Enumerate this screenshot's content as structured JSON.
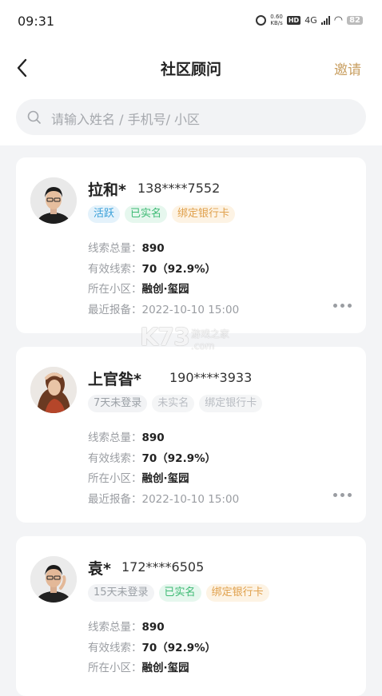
{
  "status_bar": {
    "time": "09:31",
    "speed": "0.60",
    "speed_unit": "KB/s",
    "hd": "HD",
    "network": "4G",
    "battery": "82"
  },
  "nav": {
    "title": "社区顾问",
    "invite": "邀请"
  },
  "search": {
    "placeholder": "请输入姓名 / 手机号/ 小区"
  },
  "labels": {
    "total": "线索总量：",
    "valid": "有效线索：",
    "community": "所在小区：",
    "recent": "最近报备："
  },
  "advisors": [
    {
      "name": "拉和*",
      "phone": "138****7552",
      "tags": [
        {
          "text": "活跃",
          "style": "blue"
        },
        {
          "text": "已实名",
          "style": "green"
        },
        {
          "text": "绑定银行卡",
          "style": "orange"
        }
      ],
      "total": "890",
      "valid": "70（92.9%）",
      "community": "融创·玺园",
      "recent": "2022-10-10 15:00"
    },
    {
      "name": "上官昝*",
      "phone": "190****3933",
      "tags": [
        {
          "text": "7天未登录",
          "style": "gray"
        },
        {
          "text": "未实名",
          "style": "grayl"
        },
        {
          "text": "绑定银行卡",
          "style": "grayl"
        }
      ],
      "total": "890",
      "valid": "70（92.9%）",
      "community": "融创·玺园",
      "recent": "2022-10-10 15:00"
    },
    {
      "name": "袁*",
      "phone": "172****6505",
      "tags": [
        {
          "text": "15天未登录",
          "style": "gray"
        },
        {
          "text": "已实名",
          "style": "green"
        },
        {
          "text": "绑定银行卡",
          "style": "orange"
        }
      ],
      "total": "890",
      "valid": "70（92.9%）",
      "community": "融创·玺园"
    }
  ],
  "watermark": {
    "logo": "K73",
    "cn": "游戏之家",
    "domain": ".com"
  },
  "colors": {
    "accent": "#c9a063",
    "active_tag": "#3aa0d8",
    "verified_tag": "#3dba74",
    "bank_tag": "#e0a04c"
  }
}
